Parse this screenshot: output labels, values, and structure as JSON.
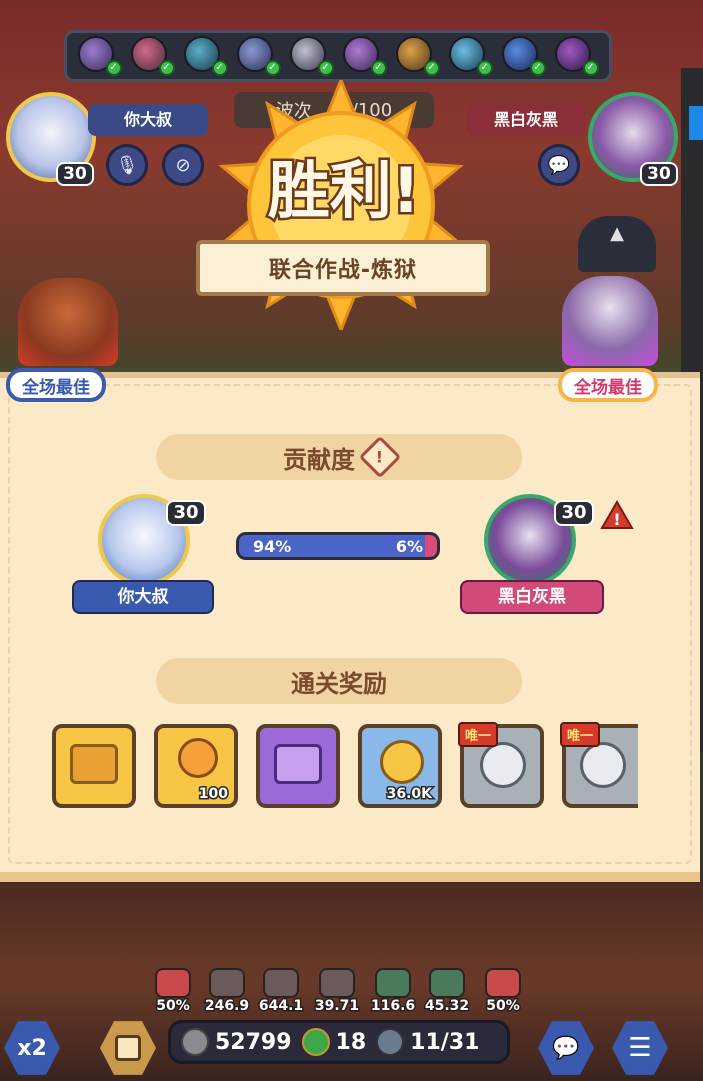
{
  "top": {
    "wave_label": "波次",
    "wave_value": "/100",
    "left_player": {
      "name": "你大叔",
      "level": "30"
    },
    "right_player": {
      "name": "黑白灰黑",
      "level": "30"
    }
  },
  "victory": {
    "title": "胜利!",
    "mode": "联合作战-炼狱"
  },
  "mvp": {
    "left_label": "全场最佳",
    "right_label": "全场最佳"
  },
  "contribution": {
    "title": "贡献度",
    "left": {
      "name": "你大叔",
      "level": "30",
      "percent_label": "94%",
      "share": 0.94
    },
    "right": {
      "name": "黑白灰黑",
      "level": "30",
      "percent_label": "6%",
      "share": 0.06
    }
  },
  "rewards": {
    "title": "通关奖励",
    "items": [
      {
        "icon": "gold-chest-icon",
        "qty": "",
        "tag": ""
      },
      {
        "icon": "key-icon",
        "qty": "100",
        "tag": ""
      },
      {
        "icon": "purple-chest-icon",
        "qty": "",
        "tag": ""
      },
      {
        "icon": "coin-icon",
        "qty": "36.0K",
        "tag": ""
      },
      {
        "icon": "silver-emblem-icon",
        "qty": "",
        "tag": "唯一"
      },
      {
        "icon": "silver-emblem-icon",
        "qty": "",
        "tag": "唯一"
      }
    ]
  },
  "stats": [
    "50%",
    "246.9",
    "644.1",
    "39.71",
    "116.6",
    "45.32",
    "50%"
  ],
  "resources": {
    "silver": "52799",
    "clover": "18",
    "units": "11/31"
  },
  "speed_label": "x2",
  "colors": {
    "panel": "#fbe9c8",
    "blue": "#4a64c8",
    "pink": "#d94c7a",
    "gold": "#f6c544"
  }
}
